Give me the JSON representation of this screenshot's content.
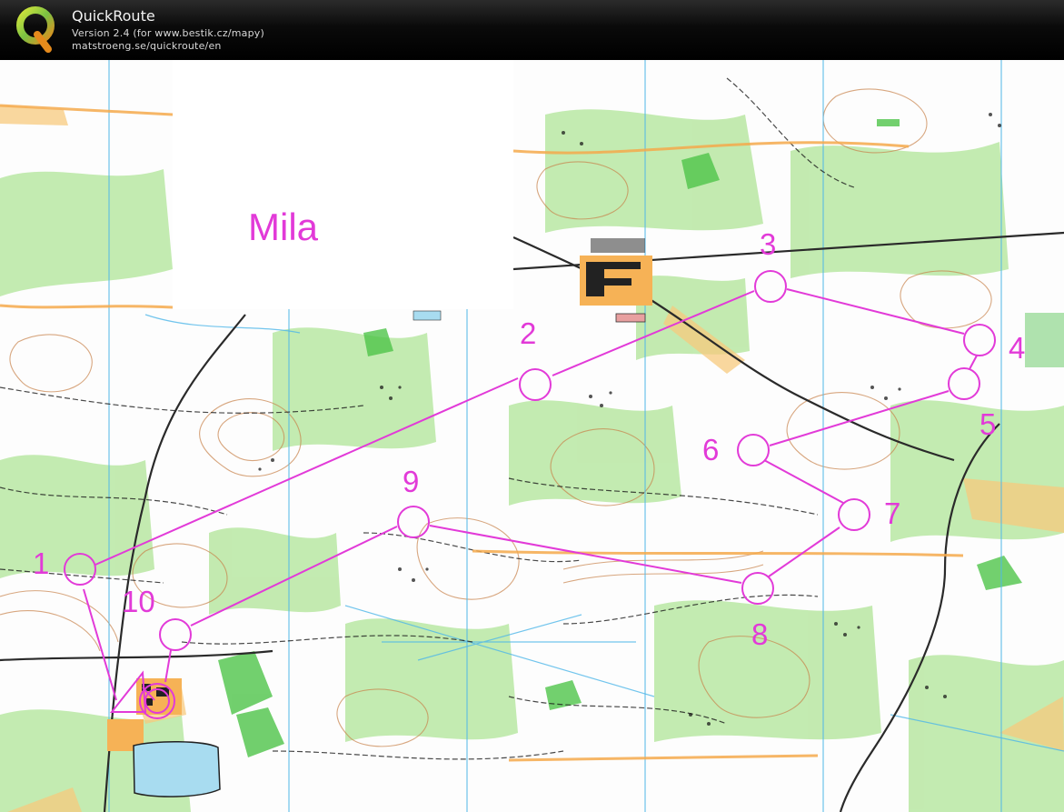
{
  "app": {
    "title": "QuickRoute",
    "version": "Version 2.4  (for www.bestik.cz/mapy)",
    "url": "matstroeng.se/quickroute/en",
    "logo_letter": "Q"
  },
  "map": {
    "label": "Mila",
    "course_color": "#e23ad8",
    "water_color": "#a8dcf0",
    "forest_color": "#b8e6a0",
    "open_color": "#f6c87a",
    "contour_color": "#c8824a",
    "start_icon": "start-triangle",
    "finish_icon": "finish-double-circle",
    "control_icon": "control-circle",
    "controls": [
      {
        "number": "1"
      },
      {
        "number": "2"
      },
      {
        "number": "3"
      },
      {
        "number": "4"
      },
      {
        "number": "5"
      },
      {
        "number": "6"
      },
      {
        "number": "7"
      },
      {
        "number": "8"
      },
      {
        "number": "9"
      },
      {
        "number": "10"
      }
    ]
  }
}
